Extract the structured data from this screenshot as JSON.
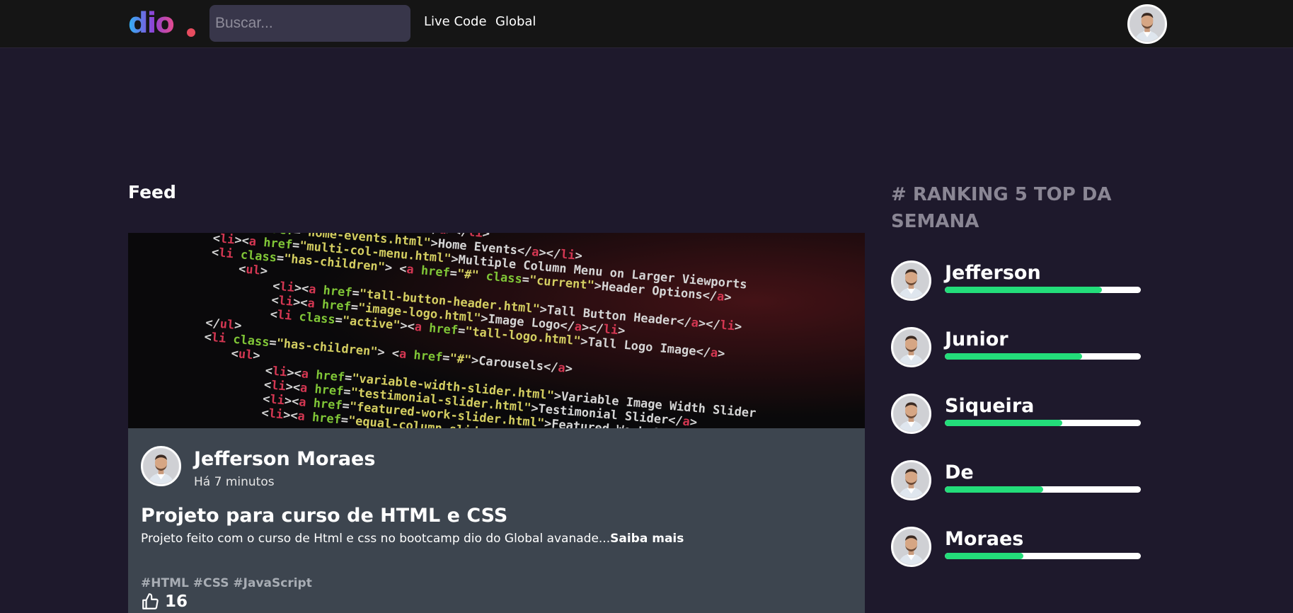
{
  "header": {
    "search_placeholder": "Buscar...",
    "nav": [
      "Live Code",
      "Global"
    ]
  },
  "feed": {
    "title": "Feed",
    "post": {
      "author": "Jefferson Moraes",
      "time": "Há 7 minutos",
      "title": "Projeto para curso de HTML e CSS",
      "description": "Projeto feito com o curso de Html e css no bootcamp dio do Global avanade...",
      "more_label": "Saiba mais",
      "tags": "#HTML #CSS #JavaScript",
      "likes": "16"
    }
  },
  "ranking": {
    "title": "# RANKING 5 TOP DA SEMANA",
    "items": [
      {
        "name": "Jefferson",
        "progress": 0.8
      },
      {
        "name": "Junior",
        "progress": 0.7
      },
      {
        "name": "Siqueira",
        "progress": 0.6
      },
      {
        "name": "De",
        "progress": 0.5
      },
      {
        "name": "Moraes",
        "progress": 0.4
      }
    ]
  },
  "colors": {
    "background": "#1e192c",
    "header": "#151515",
    "card": "#3d454f",
    "progress": "#23dd7a",
    "ranking_title": "#8a8694"
  }
}
